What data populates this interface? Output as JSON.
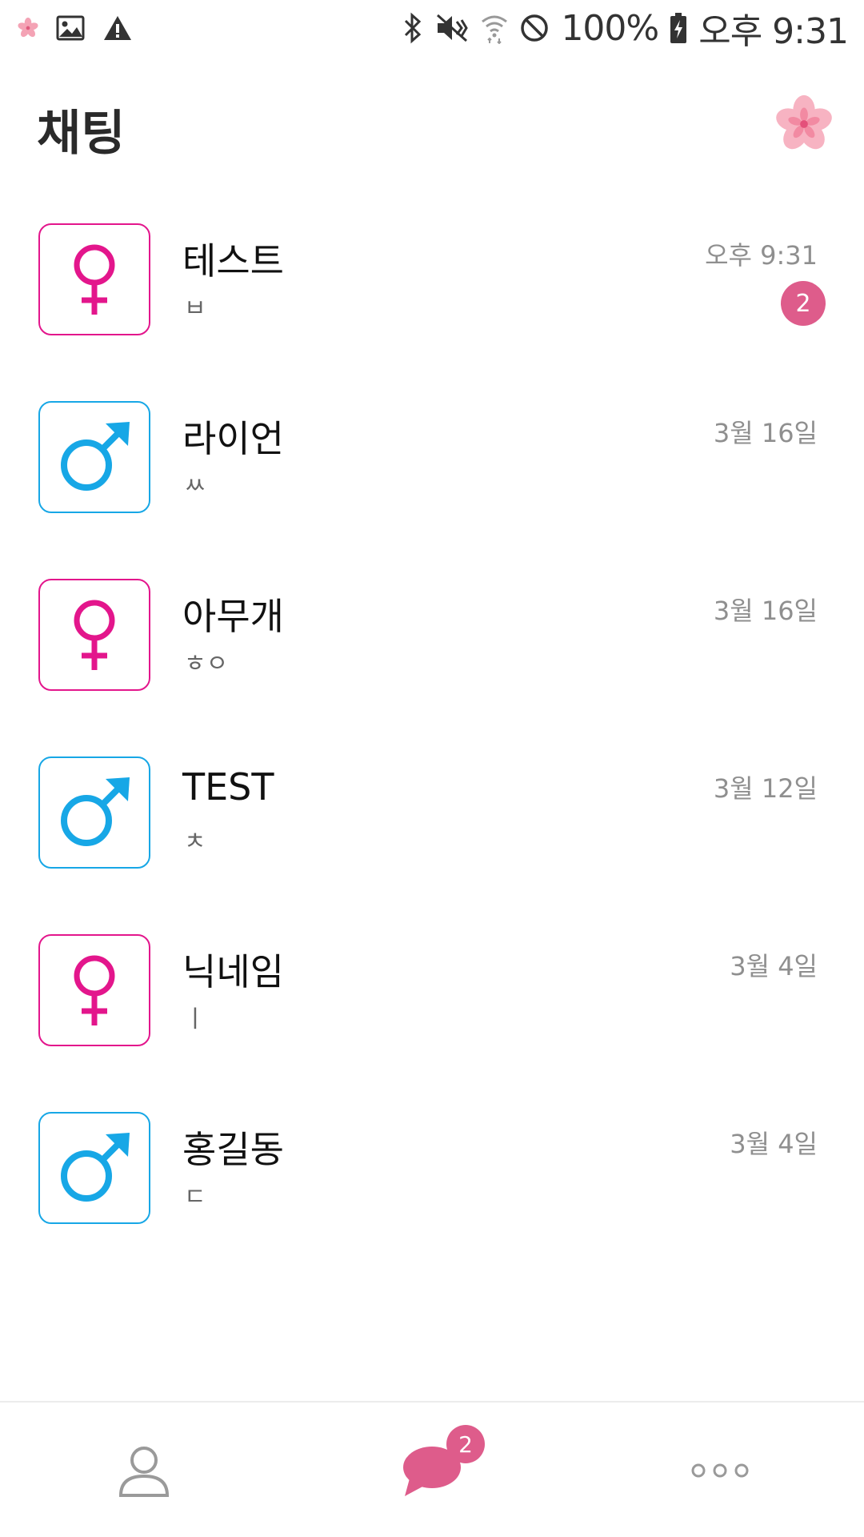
{
  "status_bar": {
    "battery": "100%",
    "time": "오후 9:31",
    "left_icons": [
      "cherry-blossom-icon",
      "image-icon",
      "warning-icon"
    ],
    "right_icons": [
      "bluetooth-icon",
      "vibrate-mute-icon",
      "wifi-icon",
      "do-not-disturb-icon",
      "battery-charging-icon"
    ]
  },
  "header": {
    "title": "채팅",
    "icon": "cherry-blossom-icon"
  },
  "colors": {
    "female": "#e3168c",
    "male": "#17a7e6",
    "badge": "#de5c8b",
    "date_text": "#8f8f8f"
  },
  "chats": [
    {
      "name": "테스트",
      "preview": "ㅂ",
      "date": "오후 9:31",
      "gender": "female",
      "icon": "female-symbol-icon",
      "unread": "2"
    },
    {
      "name": "라이언",
      "preview": "ㅆ",
      "date": "3월 16일",
      "gender": "male",
      "icon": "male-symbol-icon"
    },
    {
      "name": "아무개",
      "preview": "ㅎㅇ",
      "date": "3월 16일",
      "gender": "female",
      "icon": "female-symbol-icon"
    },
    {
      "name": "TEST",
      "preview": "ㅊ",
      "date": "3월 12일",
      "gender": "male",
      "icon": "male-symbol-icon"
    },
    {
      "name": "닉네임",
      "preview": "ㅣ",
      "date": "3월 4일",
      "gender": "female",
      "icon": "female-symbol-icon"
    },
    {
      "name": "홍길동",
      "preview": "ㄷ",
      "date": "3월 4일",
      "gender": "male",
      "icon": "male-symbol-icon"
    }
  ],
  "bottom_nav": {
    "items": [
      {
        "icon": "person-icon"
      },
      {
        "icon": "chat-bubble-icon",
        "badge": "2",
        "active": true
      },
      {
        "icon": "more-dots-icon"
      }
    ]
  }
}
